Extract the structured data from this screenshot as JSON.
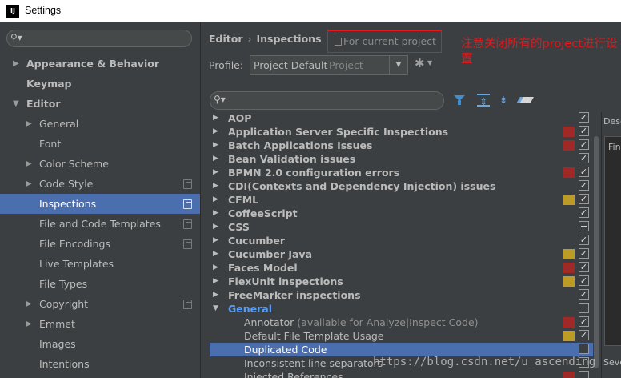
{
  "window": {
    "title": "Settings",
    "app_icon": "IJ"
  },
  "sidebar": {
    "search_placeholder": "",
    "items": [
      {
        "label": "Appearance & Behavior",
        "arrow": "▶",
        "bold": true,
        "level": 0,
        "project": false,
        "selected": false
      },
      {
        "label": "Keymap",
        "arrow": "",
        "bold": true,
        "level": 0,
        "project": false,
        "selected": false
      },
      {
        "label": "Editor",
        "arrow": "▼",
        "bold": true,
        "level": 0,
        "project": false,
        "selected": false
      },
      {
        "label": "General",
        "arrow": "▶",
        "bold": false,
        "level": 1,
        "project": false,
        "selected": false
      },
      {
        "label": "Font",
        "arrow": "",
        "bold": false,
        "level": 1,
        "project": false,
        "selected": false
      },
      {
        "label": "Color Scheme",
        "arrow": "▶",
        "bold": false,
        "level": 1,
        "project": false,
        "selected": false
      },
      {
        "label": "Code Style",
        "arrow": "▶",
        "bold": false,
        "level": 1,
        "project": true,
        "selected": false
      },
      {
        "label": "Inspections",
        "arrow": "",
        "bold": false,
        "level": 1,
        "project": true,
        "selected": true
      },
      {
        "label": "File and Code Templates",
        "arrow": "",
        "bold": false,
        "level": 1,
        "project": true,
        "selected": false
      },
      {
        "label": "File Encodings",
        "arrow": "",
        "bold": false,
        "level": 1,
        "project": true,
        "selected": false
      },
      {
        "label": "Live Templates",
        "arrow": "",
        "bold": false,
        "level": 1,
        "project": false,
        "selected": false
      },
      {
        "label": "File Types",
        "arrow": "",
        "bold": false,
        "level": 1,
        "project": false,
        "selected": false
      },
      {
        "label": "Copyright",
        "arrow": "▶",
        "bold": false,
        "level": 1,
        "project": true,
        "selected": false
      },
      {
        "label": "Emmet",
        "arrow": "▶",
        "bold": false,
        "level": 1,
        "project": false,
        "selected": false
      },
      {
        "label": "Images",
        "arrow": "",
        "bold": false,
        "level": 1,
        "project": false,
        "selected": false
      },
      {
        "label": "Intentions",
        "arrow": "",
        "bold": false,
        "level": 1,
        "project": false,
        "selected": false
      }
    ]
  },
  "header": {
    "breadcrumb_parent": "Editor",
    "breadcrumb_separator": "›",
    "breadcrumb_current": "Inspections",
    "scope_badge": "For current project",
    "annotation": "注意关闭所有的project进行设置"
  },
  "profile": {
    "label": "Profile:",
    "value": "Project Default",
    "scope": "Project",
    "dropdown_arrow": "▼",
    "gear_glyph": "✱",
    "gear_caret": "▼"
  },
  "toolbar": {
    "search_placeholder": "",
    "expand_glyph": "⇕",
    "collapse_glyph": "⇟"
  },
  "inspections": [
    {
      "name": "AOP",
      "arrow": "▶",
      "type": "group",
      "severity": "",
      "check": "✓"
    },
    {
      "name": "Application Server Specific Inspections",
      "arrow": "▶",
      "type": "group",
      "severity": "red",
      "check": "✓"
    },
    {
      "name": "Batch Applications Issues",
      "arrow": "▶",
      "type": "group",
      "severity": "red",
      "check": "✓"
    },
    {
      "name": "Bean Validation issues",
      "arrow": "▶",
      "type": "group",
      "severity": "",
      "check": "✓"
    },
    {
      "name": "BPMN 2.0 configuration errors",
      "arrow": "▶",
      "type": "group",
      "severity": "red",
      "check": "✓"
    },
    {
      "name": "CDI(Contexts and Dependency Injection) issues",
      "arrow": "▶",
      "type": "group",
      "severity": "",
      "check": "✓"
    },
    {
      "name": "CFML",
      "arrow": "▶",
      "type": "group",
      "severity": "yellow",
      "check": "✓"
    },
    {
      "name": "CoffeeScript",
      "arrow": "▶",
      "type": "group",
      "severity": "",
      "check": "✓"
    },
    {
      "name": "CSS",
      "arrow": "▶",
      "type": "group",
      "severity": "",
      "check": "partial"
    },
    {
      "name": "Cucumber",
      "arrow": "▶",
      "type": "group",
      "severity": "",
      "check": "✓"
    },
    {
      "name": "Cucumber Java",
      "arrow": "▶",
      "type": "group",
      "severity": "yellow",
      "check": "✓"
    },
    {
      "name": "Faces Model",
      "arrow": "▶",
      "type": "group",
      "severity": "red",
      "check": "✓"
    },
    {
      "name": "FlexUnit inspections",
      "arrow": "▶",
      "type": "group",
      "severity": "yellow",
      "check": "✓"
    },
    {
      "name": "FreeMarker inspections",
      "arrow": "▶",
      "type": "group",
      "severity": "",
      "check": "✓"
    },
    {
      "name": "General",
      "arrow": "▼",
      "type": "open-group",
      "severity": "",
      "check": "partial"
    },
    {
      "name": "Annotator",
      "note": "(available for Analyze|Inspect Code)",
      "arrow": "",
      "type": "leaf",
      "severity": "red",
      "check": "✓"
    },
    {
      "name": "Default File Template Usage",
      "arrow": "",
      "type": "leaf",
      "severity": "yellow",
      "check": "✓"
    },
    {
      "name": "Duplicated Code",
      "arrow": "",
      "type": "leaf",
      "severity": "",
      "check": "",
      "selected": true
    },
    {
      "name": "Inconsistent line separators",
      "arrow": "",
      "type": "leaf",
      "severity": "",
      "check": ""
    },
    {
      "name": "Injected References",
      "arrow": "",
      "type": "leaf",
      "severity": "red",
      "check": ""
    }
  ],
  "description": {
    "title": "Desc",
    "text": "Fin",
    "bottom": "Seve"
  },
  "watermark": "https://blog.csdn.net/u_ascending",
  "colors": {
    "selection": "#4b6eaf",
    "severity_red": "#9e2927",
    "severity_yellow": "#bd9b27",
    "annotation": "#e8161b",
    "group_open": "#589df6"
  }
}
